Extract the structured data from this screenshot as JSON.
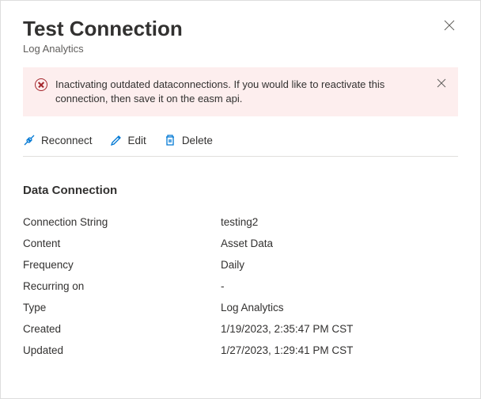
{
  "header": {
    "title": "Test Connection",
    "subtitle": "Log Analytics"
  },
  "alert": {
    "message": "Inactivating outdated dataconnections. If you would like to reactivate this connection, then save it on the easm api."
  },
  "toolbar": {
    "reconnect_label": "Reconnect",
    "edit_label": "Edit",
    "delete_label": "Delete"
  },
  "section": {
    "heading": "Data Connection",
    "fields": {
      "connection_string": {
        "label": "Connection String",
        "value": "testing2"
      },
      "content": {
        "label": "Content",
        "value": "Asset Data"
      },
      "frequency": {
        "label": "Frequency",
        "value": "Daily"
      },
      "recurring_on": {
        "label": "Recurring on",
        "value": "-"
      },
      "type": {
        "label": "Type",
        "value": "Log Analytics"
      },
      "created": {
        "label": "Created",
        "value": "1/19/2023, 2:35:47 PM CST"
      },
      "updated": {
        "label": "Updated",
        "value": "1/27/2023, 1:29:41 PM CST"
      }
    }
  }
}
